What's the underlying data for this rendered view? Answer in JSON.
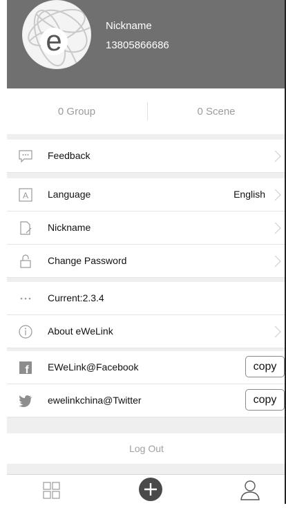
{
  "header": {
    "nickname": "Nickname",
    "phone": "13805866686",
    "avatar_letter": "e"
  },
  "stats": {
    "group": "0 Group",
    "scene": "0 Scene"
  },
  "menu": {
    "feedback": "Feedback",
    "language": "Language",
    "language_value": "English",
    "nickname": "Nickname",
    "change_password": "Change Password",
    "current_version": "Current:2.3.4",
    "about": "About eWeLink",
    "facebook": "EWeLink@Facebook",
    "twitter": "ewelinkchina@Twitter",
    "copy_label": "copy",
    "language_icon_letter": "A",
    "facebook_icon_letter": "f"
  },
  "logout": "Log Out",
  "colors": {
    "header_bg": "#707070",
    "separator_bg": "#efefef",
    "muted_text": "#9b9b9b"
  },
  "icons": [
    "avatar-logo",
    "feedback-icon",
    "language-icon",
    "nickname-icon",
    "lock-icon",
    "dots-icon",
    "info-icon",
    "facebook-icon",
    "twitter-icon",
    "grid-icon",
    "add-icon",
    "profile-icon",
    "chevron-right-icon"
  ]
}
